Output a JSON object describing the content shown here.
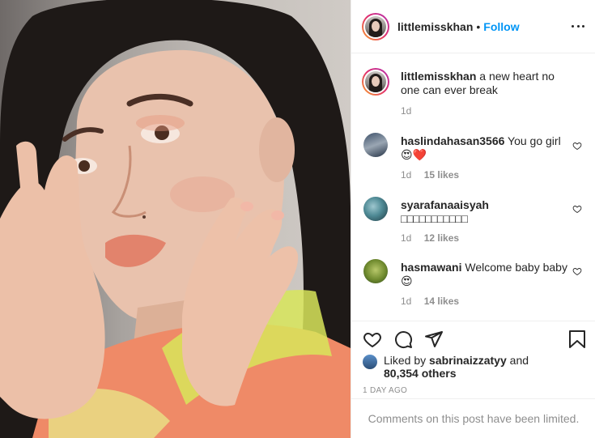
{
  "post": {
    "author": "littlemisskhan",
    "separator": "•",
    "follow_label": "Follow",
    "more_icon": "more-horizontal-icon",
    "caption_text": "a new heart no one can ever break",
    "caption_time": "1d"
  },
  "comments": [
    {
      "username": "haslindahasan3566",
      "text": "You go girl",
      "emoji": "😍❤️",
      "time": "1d",
      "likes": "15 likes"
    },
    {
      "username": "syarafanaaisyah",
      "text": "□□□□□□□□□□□",
      "time": "1d",
      "likes": "12 likes"
    },
    {
      "username": "hasmawani",
      "text": "Welcome baby baby",
      "emoji": "😍",
      "time": "1d",
      "likes": "14 likes"
    }
  ],
  "actions": {
    "icons": [
      "heart-icon",
      "comment-icon",
      "share-icon",
      "bookmark-icon"
    ],
    "liked_prefix": "Liked by",
    "liked_user": "sabrinaizzatyy",
    "liked_and": "and",
    "liked_others": "80,354 others",
    "date": "1 DAY AGO"
  },
  "limited_text": "Comments on this post have been limited.",
  "colors": {
    "accent": "#0095f6",
    "text": "#262626",
    "muted": "#8e8e8e",
    "border": "#efefef"
  }
}
